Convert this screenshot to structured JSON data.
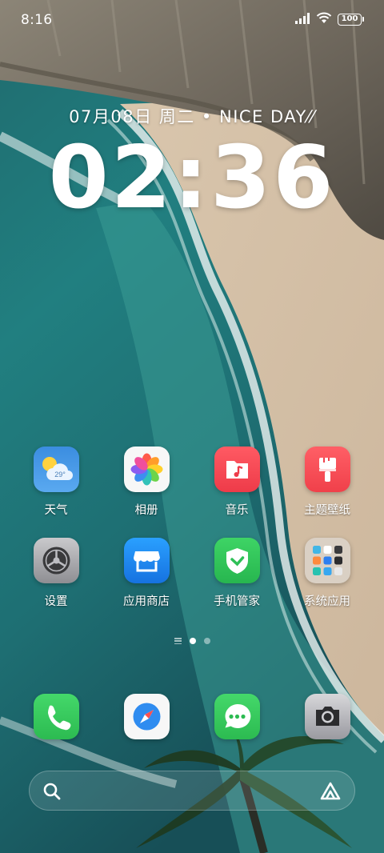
{
  "status_bar": {
    "time": "8:16",
    "battery": "100"
  },
  "clock_widget": {
    "date_line": "07月08日 周二 • NICE DAY⁄⁄",
    "time": "02:36"
  },
  "apps": [
    {
      "label": "天气",
      "icon": "weather-icon",
      "badge_text": "29°"
    },
    {
      "label": "相册",
      "icon": "gallery-icon"
    },
    {
      "label": "音乐",
      "icon": "music-icon"
    },
    {
      "label": "主题壁纸",
      "icon": "theme-brush-icon"
    },
    {
      "label": "设置",
      "icon": "settings-gear-icon"
    },
    {
      "label": "应用商店",
      "icon": "app-store-icon"
    },
    {
      "label": "手机管家",
      "icon": "phone-manager-shield-icon"
    },
    {
      "label": "系统应用",
      "icon": "system-apps-folder-icon"
    }
  ],
  "dock": [
    {
      "icon": "phone-icon"
    },
    {
      "icon": "browser-compass-icon"
    },
    {
      "icon": "messages-icon"
    },
    {
      "icon": "camera-icon"
    }
  ],
  "page_indicator": {
    "pages": 2,
    "active_page": 1
  },
  "search_bar": {
    "left_icon": "search-icon",
    "right_icon": "assistant-icon"
  },
  "colors": {
    "music": "#f0434f",
    "theme": "#f24a52",
    "app_store": "#1e88f0",
    "phone_manager": "#33c65b",
    "phone": "#36c95a",
    "messages": "#37c95a"
  }
}
